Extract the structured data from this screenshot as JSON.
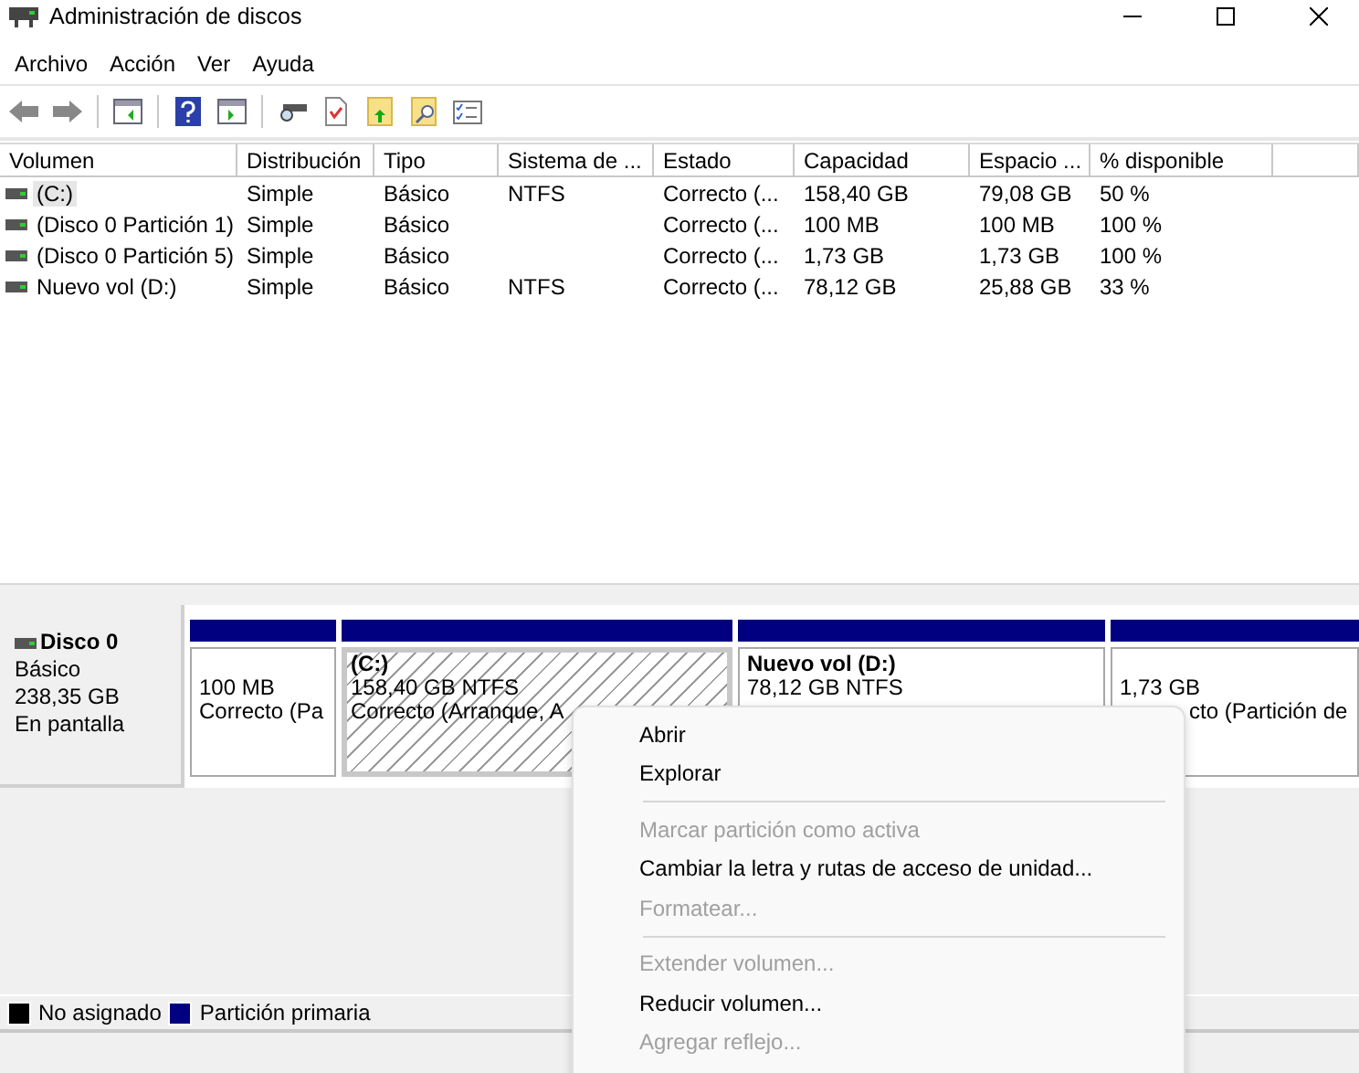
{
  "window": {
    "title": "Administración de discos"
  },
  "menu": [
    "Archivo",
    "Acción",
    "Ver",
    "Ayuda"
  ],
  "table": {
    "columns": [
      "Volumen",
      "Distribución",
      "Tipo",
      "Sistema de ...",
      "Estado",
      "Capacidad",
      "Espacio ...",
      "% disponible"
    ],
    "rows": [
      {
        "selected": true,
        "cells": [
          "(C:)",
          "Simple",
          "Básico",
          "NTFS",
          "Correcto (...",
          "158,40 GB",
          "79,08 GB",
          "50 %"
        ]
      },
      {
        "selected": false,
        "cells": [
          "(Disco 0 Partición 1)",
          "Simple",
          "Básico",
          "",
          "Correcto (...",
          "100 MB",
          "100 MB",
          "100 %"
        ]
      },
      {
        "selected": false,
        "cells": [
          "(Disco 0 Partición 5)",
          "Simple",
          "Básico",
          "",
          "Correcto (...",
          "1,73 GB",
          "1,73 GB",
          "100 %"
        ]
      },
      {
        "selected": false,
        "cells": [
          "Nuevo vol (D:)",
          "Simple",
          "Básico",
          "NTFS",
          "Correcto (...",
          "78,12 GB",
          "25,88 GB",
          "33 %"
        ]
      }
    ]
  },
  "disk": {
    "name": "Disco 0",
    "type": "Básico",
    "size": "238,35 GB",
    "status": "En pantalla",
    "partitions": [
      {
        "selected": false,
        "lines": [
          "100 MB",
          "Correcto (Pa"
        ]
      },
      {
        "selected": true,
        "title": "(C:)",
        "lines": [
          "158,40 GB NTFS",
          "Correcto (Arranque, A"
        ]
      },
      {
        "selected": false,
        "title": "Nuevo vol  (D:)",
        "lines": [
          "78,12 GB NTFS"
        ]
      },
      {
        "selected": false,
        "lines": [
          "1,73 GB",
          "cto (Partición de"
        ]
      }
    ]
  },
  "legend": [
    {
      "label": "No asignado",
      "color": "#000000"
    },
    {
      "label": "Partición primaria",
      "color": "#000080"
    }
  ],
  "context_menu": [
    {
      "kind": "item",
      "label": "Abrir",
      "disabled": false
    },
    {
      "kind": "item",
      "label": "Explorar",
      "disabled": false
    },
    {
      "kind": "separator"
    },
    {
      "kind": "item",
      "label": "Marcar partición como activa",
      "disabled": true
    },
    {
      "kind": "item",
      "label": "Cambiar la letra y rutas de acceso de unidad...",
      "disabled": false
    },
    {
      "kind": "item",
      "label": "Formatear...",
      "disabled": true
    },
    {
      "kind": "separator"
    },
    {
      "kind": "item",
      "label": "Extender volumen...",
      "disabled": true
    },
    {
      "kind": "item",
      "label": "Reducir volumen...",
      "disabled": false
    },
    {
      "kind": "item",
      "label": "Agregar reflejo...",
      "disabled": true
    }
  ]
}
